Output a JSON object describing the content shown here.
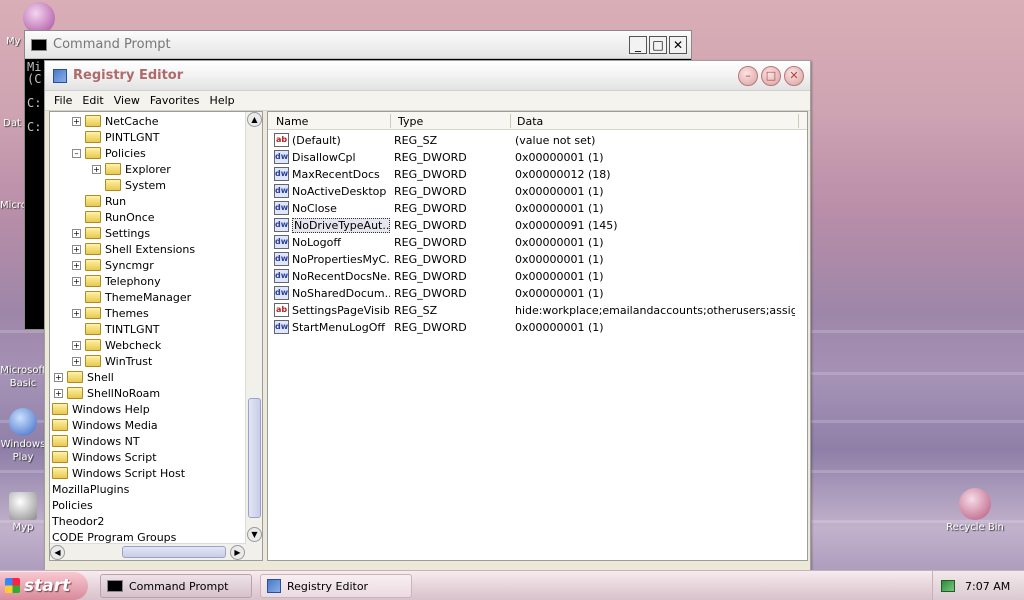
{
  "desktop": {
    "icons": [
      {
        "label": "My",
        "name": "my-documents-icon"
      },
      {
        "label": "Dat",
        "name": "data-icon"
      },
      {
        "label": "Micro",
        "name": "microsoft-icon"
      },
      {
        "label": "Microsoft Basic",
        "name": "microsoft-basic-icon"
      },
      {
        "label": "Windows Play",
        "name": "windows-player-icon"
      },
      {
        "label": "Myp",
        "name": "myp-icon"
      },
      {
        "label": "Recycle Bin",
        "name": "recycle-bin-icon"
      }
    ]
  },
  "cmd_window": {
    "title": "Command Prompt",
    "lines": [
      "Mi",
      "(C",
      "",
      "C:",
      "",
      "C:"
    ],
    "minimize": "_",
    "maximize": "□",
    "close": "✕"
  },
  "registry": {
    "title": "Registry Editor",
    "buttons": {
      "minimize": "–",
      "maximize": "□",
      "close": "✕"
    },
    "menu": [
      "File",
      "Edit",
      "View",
      "Favorites",
      "Help"
    ],
    "tree": [
      {
        "label": "NetCache",
        "expander": "+"
      },
      {
        "label": "PINTLGNT",
        "expander": ""
      },
      {
        "label": "Policies",
        "expander": "–"
      },
      {
        "label": "Explorer",
        "expander": "+"
      },
      {
        "label": "System",
        "expander": ""
      },
      {
        "label": "Run",
        "expander": ""
      },
      {
        "label": "RunOnce",
        "expander": ""
      },
      {
        "label": "Settings",
        "expander": "+"
      },
      {
        "label": "Shell Extensions",
        "expander": "+"
      },
      {
        "label": "Syncmgr",
        "expander": "+"
      },
      {
        "label": "Telephony",
        "expander": "+"
      },
      {
        "label": "ThemeManager",
        "expander": ""
      },
      {
        "label": "Themes",
        "expander": "+"
      },
      {
        "label": "TINTLGNT",
        "expander": ""
      },
      {
        "label": "Webcheck",
        "expander": "+"
      },
      {
        "label": "WinTrust",
        "expander": "+"
      },
      {
        "label": "Shell",
        "expander": "+"
      },
      {
        "label": "ShellNoRoam",
        "expander": "+"
      },
      {
        "label": "Windows Help",
        "expander": ""
      },
      {
        "label": "Windows Media",
        "expander": ""
      },
      {
        "label": "Windows NT",
        "expander": ""
      },
      {
        "label": "Windows Script",
        "expander": ""
      },
      {
        "label": "Windows Script Host",
        "expander": ""
      },
      {
        "label": "MozillaPlugins",
        "expander": ""
      },
      {
        "label": "Policies",
        "expander": ""
      },
      {
        "label": "Theodor2",
        "expander": ""
      },
      {
        "label": "CODE Program Groups",
        "expander": ""
      }
    ],
    "columns": {
      "name": "Name",
      "type": "Type",
      "data": "Data"
    },
    "values": [
      {
        "name": "(Default)",
        "type": "REG_SZ",
        "data": "(value not set)",
        "icon": "ab"
      },
      {
        "name": "DisallowCpl",
        "type": "REG_DWORD",
        "data": "0x00000001 (1)",
        "icon": "dw"
      },
      {
        "name": "MaxRecentDocs",
        "type": "REG_DWORD",
        "data": "0x00000012 (18)",
        "icon": "dw"
      },
      {
        "name": "NoActiveDesktop",
        "type": "REG_DWORD",
        "data": "0x00000001 (1)",
        "icon": "dw"
      },
      {
        "name": "NoClose",
        "type": "REG_DWORD",
        "data": "0x00000001 (1)",
        "icon": "dw"
      },
      {
        "name": "NoDriveTypeAut...",
        "type": "REG_DWORD",
        "data": "0x00000091 (145)",
        "icon": "dw"
      },
      {
        "name": "NoLogoff",
        "type": "REG_DWORD",
        "data": "0x00000001 (1)",
        "icon": "dw"
      },
      {
        "name": "NoPropertiesMyC...",
        "type": "REG_DWORD",
        "data": "0x00000001 (1)",
        "icon": "dw"
      },
      {
        "name": "NoRecentDocsNe...",
        "type": "REG_DWORD",
        "data": "0x00000001 (1)",
        "icon": "dw"
      },
      {
        "name": "NoSharedDocum...",
        "type": "REG_DWORD",
        "data": "0x00000001 (1)",
        "icon": "dw"
      },
      {
        "name": "SettingsPageVisib...",
        "type": "REG_SZ",
        "data": "hide:workplace;emailandaccounts;otherusers;assigned...",
        "icon": "ab"
      },
      {
        "name": "StartMenuLogOff",
        "type": "REG_DWORD",
        "data": "0x00000001 (1)",
        "icon": "dw"
      }
    ],
    "selected_index": 5
  },
  "taskbar": {
    "start": "start",
    "buttons": [
      "Command Prompt",
      "Registry Editor"
    ],
    "clock": "7:07 AM"
  }
}
